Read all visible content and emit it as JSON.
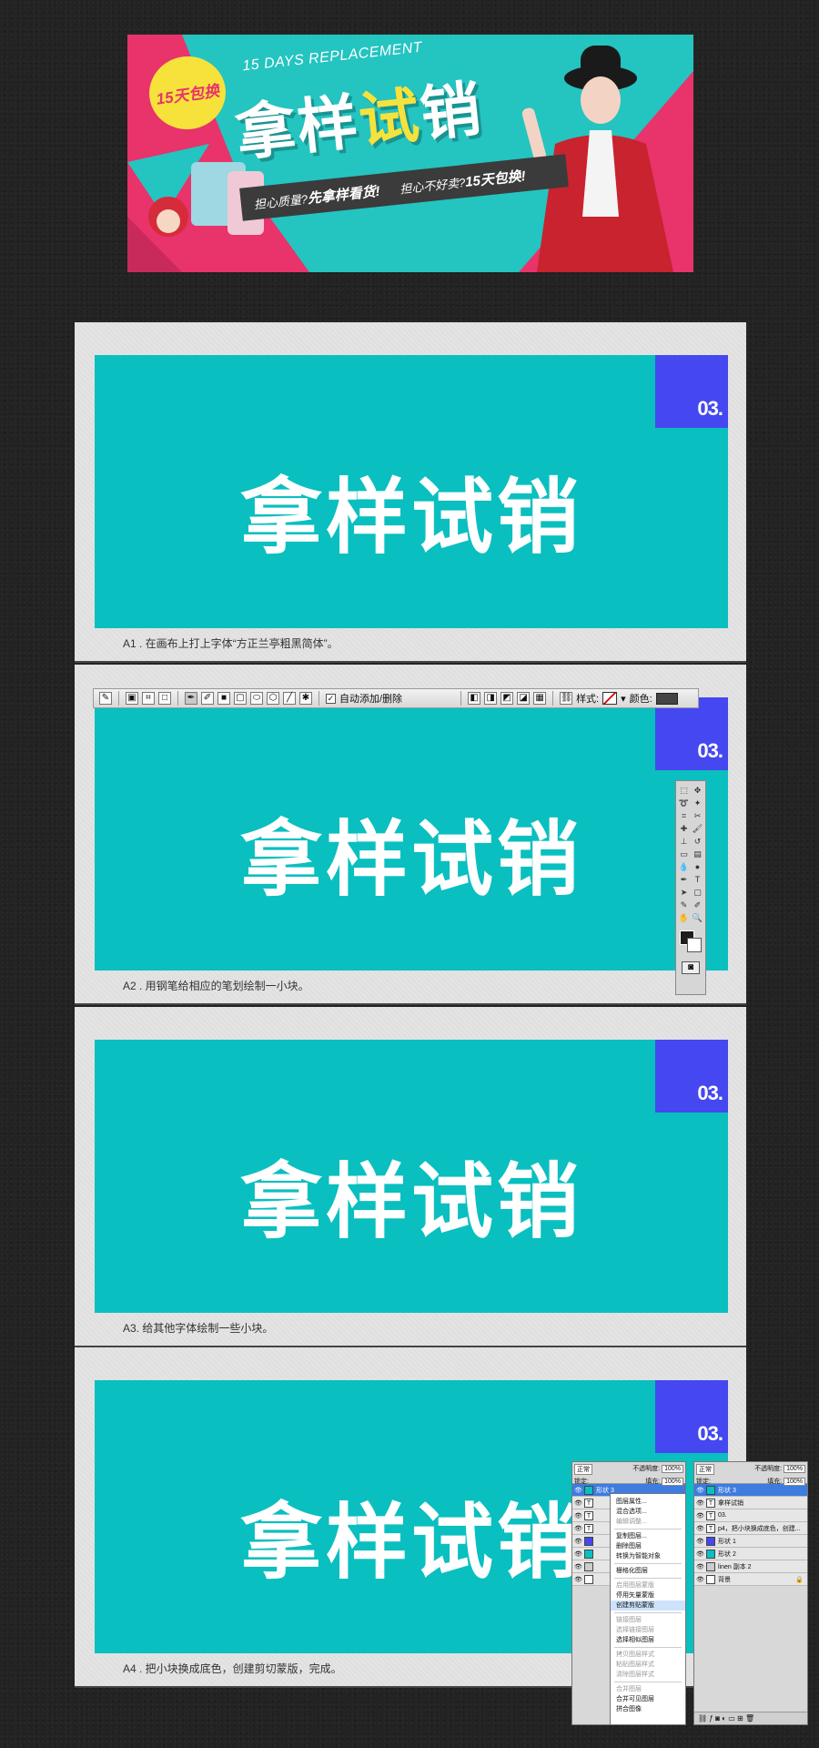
{
  "banner": {
    "badge": "15天包换",
    "subtitle": "15 DAYS REPLACEMENT",
    "title_part1": "拿样",
    "title_hl": "试",
    "title_part2": "销",
    "strip_text1": "担心质量?",
    "strip_bold1": "先拿样看货!",
    "strip_text2": "担心不好卖?",
    "strip_bold2": "15天包换!",
    "colors": {
      "pink": "#e8336b",
      "teal": "#24c4c0",
      "yellow": "#f7e23b"
    }
  },
  "steps": [
    {
      "corner": "03.",
      "big_text": "拿样试销",
      "caption": "A1 . 在画布上打上字体“方正兰亭粗黑简体”。"
    },
    {
      "corner": "03.",
      "big_text": "拿样试销",
      "caption": "A2 . 用钢笔给相应的笔划绘制一小块。"
    },
    {
      "corner": "03.",
      "big_text": "拿样试销",
      "caption": "A3. 给其他字体绘制一些小块。"
    },
    {
      "corner": "03.",
      "big_text": "拿样试销",
      "caption": "A4 . 把小块换成底色，创建剪切蒙版，完成。"
    }
  ],
  "options_bar": {
    "auto_add_delete": "自动添加/删除",
    "style_label": "样式:",
    "color_label": "颜色:"
  },
  "layers_left": {
    "blend": "正常",
    "opacity_label": "不透明度:",
    "opacity": "100%",
    "lock_label": "锁定:",
    "fill_label": "填充:",
    "fill": "100%",
    "selected_layer": "形状 3"
  },
  "context_menu": {
    "items": [
      "图层属性...",
      "混合选项...",
      "编辑调整...",
      "复制图层...",
      "删除图层",
      "转换为智能对象",
      "栅格化图层",
      "启用图层蒙版",
      "停用矢量蒙版",
      "创建剪贴蒙版",
      "链接图层",
      "选择链接图层",
      "选择相似图层",
      "拷贝图层样式",
      "粘贴图层样式",
      "清除图层样式",
      "合并图层",
      "合并可见图层",
      "拼合图像"
    ]
  },
  "layers_right": {
    "blend": "正常",
    "opacity_label": "不透明度:",
    "opacity": "100%",
    "lock_label": "锁定:",
    "fill_label": "填充:",
    "fill": "100%",
    "rows": [
      "形状 3",
      "拿样试销",
      "03.",
      "p4，把小块换成底色，创建...",
      "形状 1",
      "形状 2",
      "linen 副本 2",
      "背景"
    ]
  },
  "colors": {
    "canvas_teal": "#0abfbf",
    "corner_blue": "#4547f0",
    "page_bg": "#232323"
  }
}
